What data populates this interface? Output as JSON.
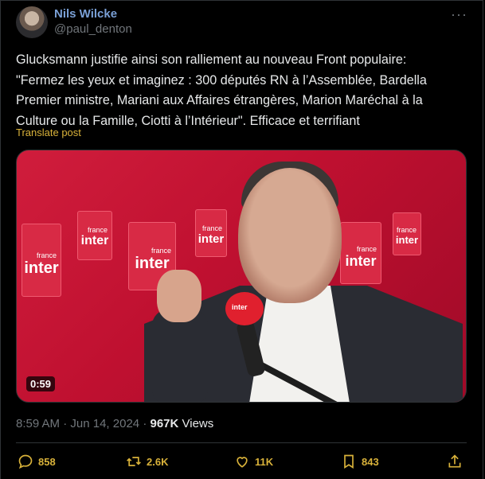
{
  "author": {
    "name": "Nils Wilcke",
    "handle": "@paul_denton"
  },
  "more_label": "···",
  "tweet": {
    "lines": [
      "Glucksmann justifie ainsi son ralliement au nouveau Front populaire:",
      "\"Fermez les yeux et imaginez : 300 députés RN à l’Assemblée, Bardella",
      "Premier ministre, Mariani aux Affaires étrangères, Marion Maréchal à la",
      "Culture ou la Famille, Ciotti à l’Intérieur\". Efficace et terrifiant"
    ],
    "translate_label": "Translate post"
  },
  "media": {
    "duration": "0:59",
    "tile_brand": "inter",
    "tile_sub": "france",
    "mic_brand": "inter"
  },
  "meta": {
    "time": "8:59 AM",
    "sep": "·",
    "date": "Jun 14, 2024",
    "views_count": "967K",
    "views_label": "Views"
  },
  "actions": {
    "replies": "858",
    "reposts": "2.6K",
    "likes": "11K",
    "bookmarks": "843"
  },
  "colors": {
    "accent": "#d9b23a",
    "name": "#7aa0d6",
    "muted": "#71767b"
  },
  "icons": [
    "more-icon",
    "reply-icon",
    "repost-icon",
    "like-icon",
    "bookmark-icon",
    "share-icon"
  ]
}
